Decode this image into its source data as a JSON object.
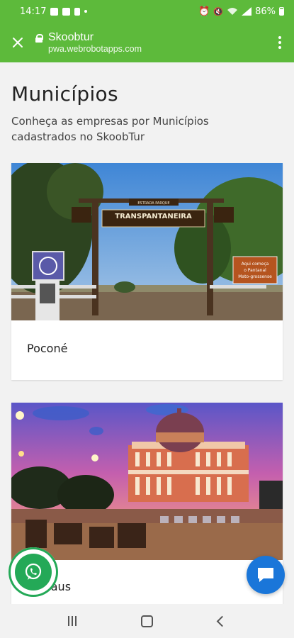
{
  "status_bar": {
    "time": "14:17",
    "battery": "86%",
    "icons": [
      "photo-icon",
      "mail-icon",
      "sim-icon",
      "dot-icon",
      "alarm-icon",
      "mute-icon",
      "wifi-icon",
      "signal-icon",
      "battery-icon"
    ]
  },
  "browser": {
    "title": "Skoobtur",
    "host": "pwa.webrobotapps.com",
    "close_icon": "close-icon",
    "lock_icon": "lock-icon",
    "menu_icon": "more-vertical-icon"
  },
  "page": {
    "title": "Municípios",
    "subtitle": "Conheça as empresas por Municípios cadastrados no SkoobTur"
  },
  "cards": [
    {
      "label": "Poconé",
      "image": "Transpantaneira entrance gate photo"
    },
    {
      "label": "Manaus",
      "image": "Teatro Amazonas at dusk photo"
    }
  ],
  "sign": {
    "main": "TRANSPANTANEIRA",
    "top": "ESTRADA PARQUE",
    "right": "Aqui começa o Pantanal Mato-grossense"
  },
  "floating": {
    "whatsapp_icon": "whatsapp-icon",
    "chat_icon": "chat-icon"
  },
  "colors": {
    "brand": "#5dba3b",
    "whatsapp": "#24a957",
    "chat": "#1a76d9"
  },
  "nav": {
    "icons": [
      "recent-apps-icon",
      "home-icon",
      "back-icon"
    ]
  }
}
